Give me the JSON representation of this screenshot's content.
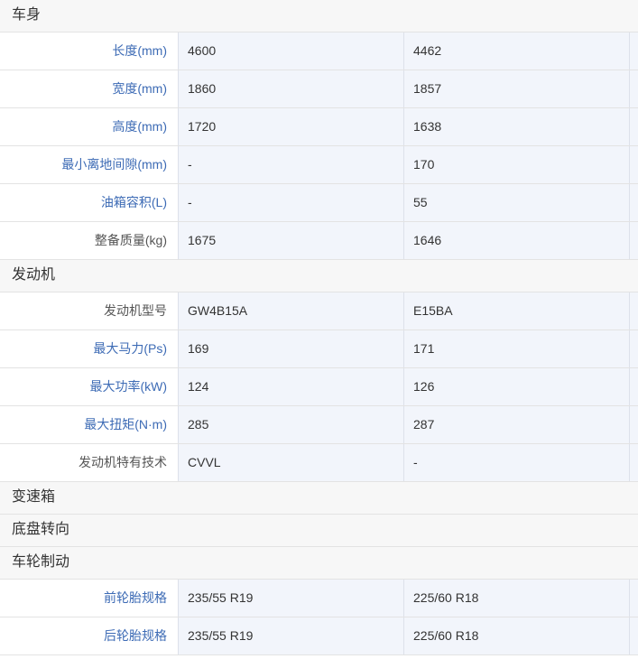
{
  "sections": [
    {
      "title": "车身",
      "rows": [
        {
          "label": "长度(mm)",
          "link": true,
          "values": [
            "4600",
            "4462"
          ]
        },
        {
          "label": "宽度(mm)",
          "link": true,
          "values": [
            "1860",
            "1857"
          ]
        },
        {
          "label": "高度(mm)",
          "link": true,
          "values": [
            "1720",
            "1638"
          ]
        },
        {
          "label": "最小离地间隙(mm)",
          "link": true,
          "values": [
            "-",
            "170"
          ]
        },
        {
          "label": "油箱容积(L)",
          "link": true,
          "values": [
            "-",
            "55"
          ]
        },
        {
          "label": "整备质量(kg)",
          "link": false,
          "values": [
            "1675",
            "1646"
          ]
        }
      ]
    },
    {
      "title": "发动机",
      "rows": [
        {
          "label": "发动机型号",
          "link": false,
          "values": [
            "GW4B15A",
            "E15BA"
          ]
        },
        {
          "label": "最大马力(Ps)",
          "link": true,
          "values": [
            "169",
            "171"
          ]
        },
        {
          "label": "最大功率(kW)",
          "link": true,
          "values": [
            "124",
            "126"
          ]
        },
        {
          "label": "最大扭矩(N·m)",
          "link": true,
          "values": [
            "285",
            "287"
          ]
        },
        {
          "label": "发动机特有技术",
          "link": false,
          "values": [
            "CVVL",
            "-"
          ]
        }
      ]
    },
    {
      "title": "变速箱",
      "rows": []
    },
    {
      "title": "底盘转向",
      "rows": []
    },
    {
      "title": "车轮制动",
      "rows": [
        {
          "label": "前轮胎规格",
          "link": true,
          "values": [
            "235/55 R19",
            "225/60 R18"
          ]
        },
        {
          "label": "后轮胎规格",
          "link": true,
          "values": [
            "235/55 R19",
            "225/60 R18"
          ]
        }
      ]
    }
  ]
}
